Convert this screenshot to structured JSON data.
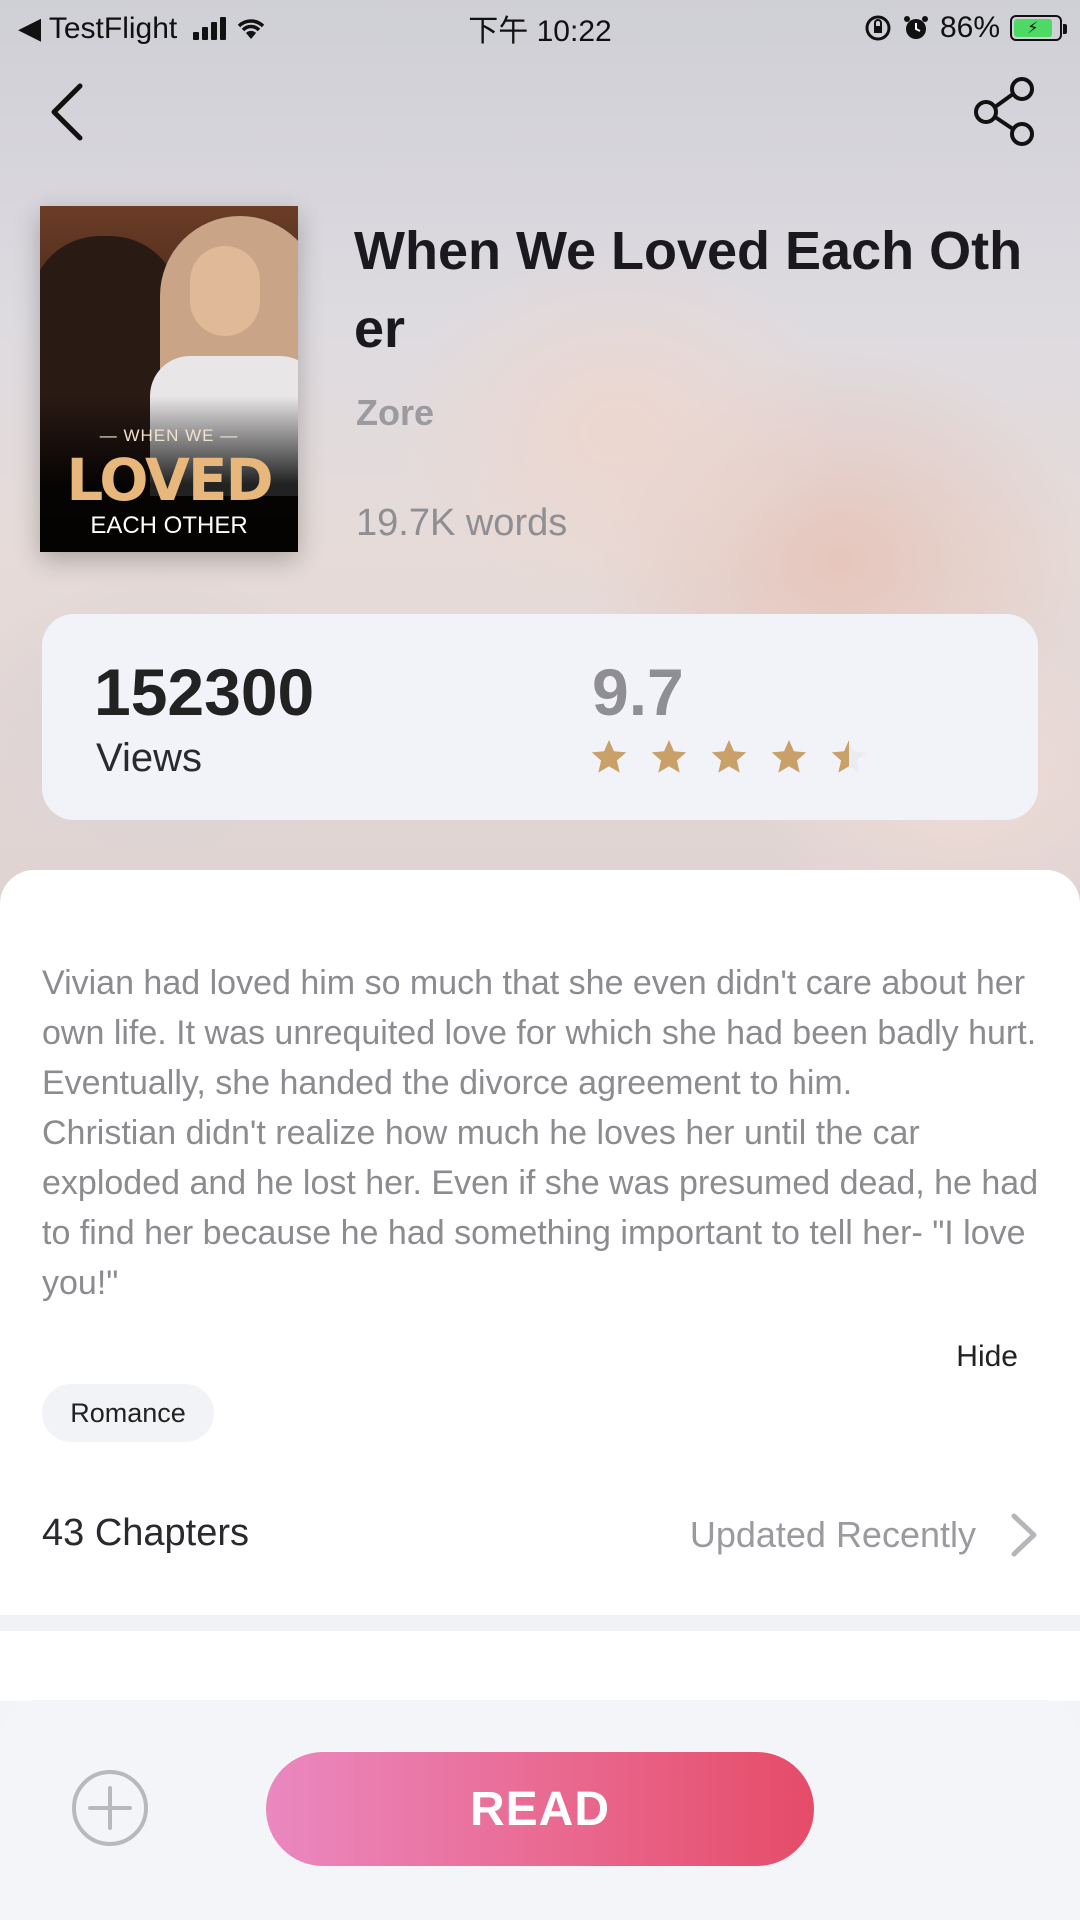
{
  "status_bar": {
    "carrier": "◀ TestFlight",
    "time": "下午 10:22",
    "battery": "86%"
  },
  "book": {
    "title": "When We Loved Each Other",
    "author": "Zore",
    "words": "19.7K words",
    "cover": {
      "line1": "— WHEN WE —",
      "line2": "LOVED",
      "line3": "EACH OTHER"
    }
  },
  "stats": {
    "views": "152300",
    "views_label": "Views",
    "rating": "9.7",
    "stars": 4.5
  },
  "description": "Vivian had loved him so much that she even didn't care about her own life. It was unrequited love for which she had been badly hurt. Eventually, she handed the divorce agreement to him.\nChristian didn't realize how much he loves her until the car exploded and he lost her. Even if she was presumed dead, he had to find her because he had something important to tell her- \"I love you!\"",
  "hide_label": "Hide",
  "tags": [
    "Romance"
  ],
  "chapters": {
    "count_label": "43 Chapters",
    "update_label": "Updated Recently"
  },
  "actions": {
    "read_label": "READ"
  },
  "icons": {
    "back": "back-chevron-icon",
    "share": "share-icon",
    "add": "add-circle-icon",
    "chevron": "chevron-right-icon",
    "star": "star-icon"
  },
  "colors": {
    "star": "#c8a068",
    "read_gradient_start": "#ea88c0",
    "read_gradient_end": "#e54c68"
  }
}
